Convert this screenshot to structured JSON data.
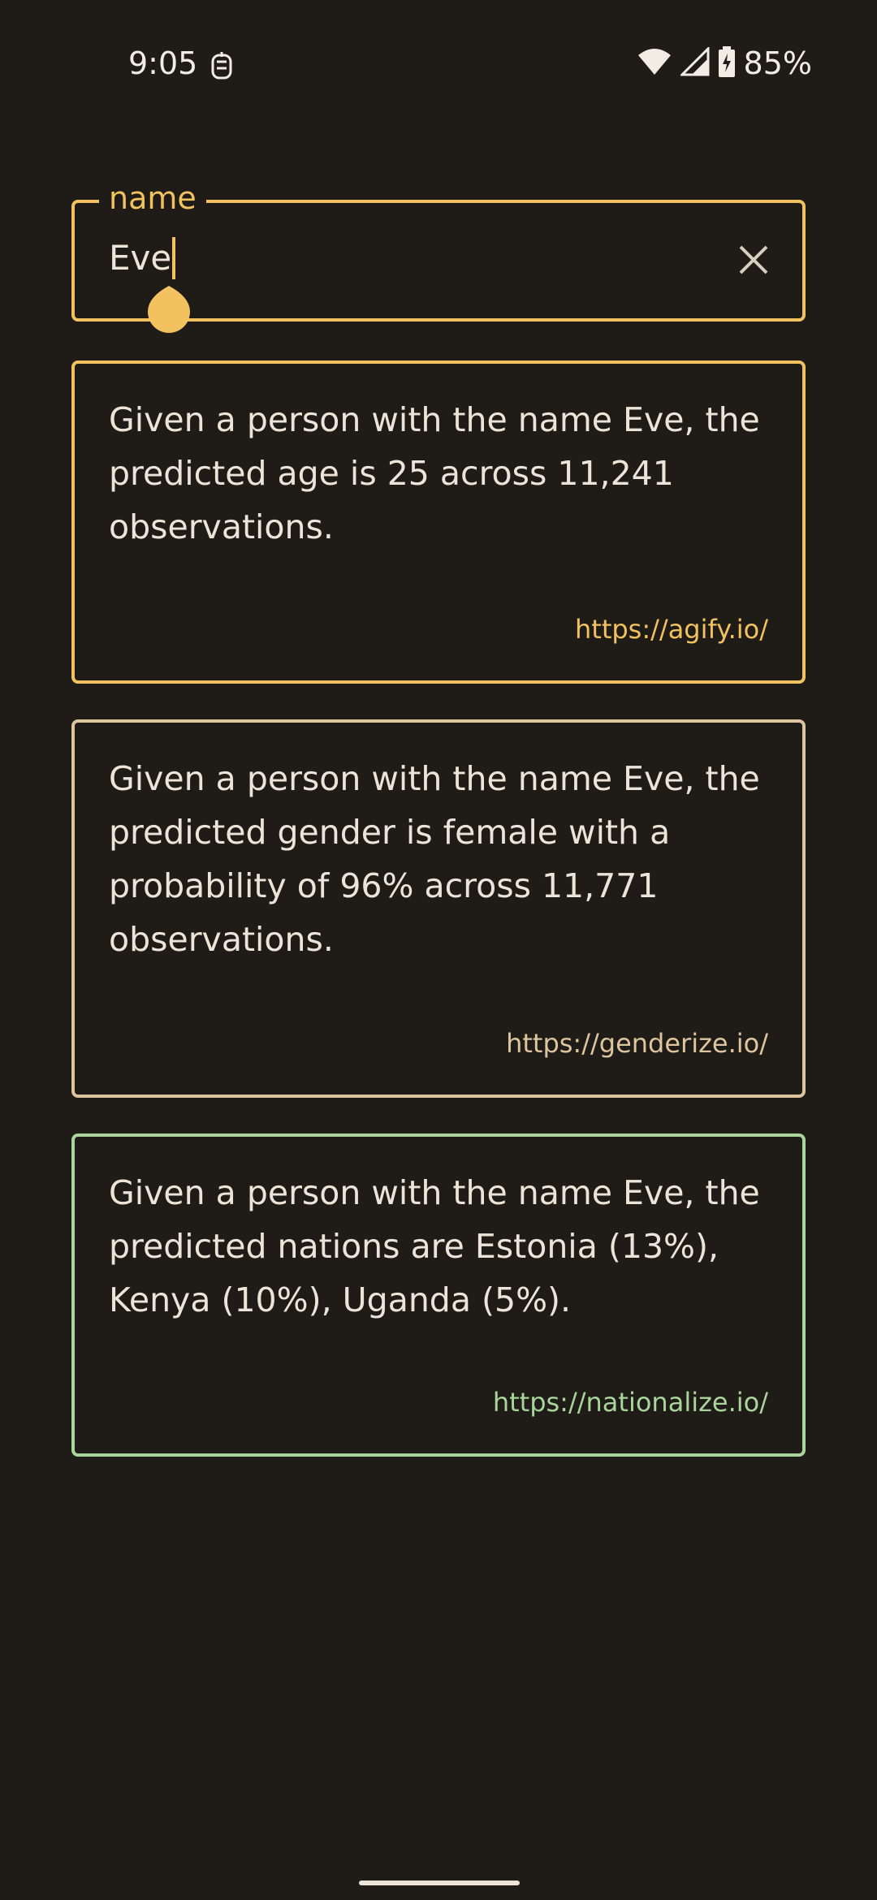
{
  "status_bar": {
    "time": "9:05",
    "battery": "85%",
    "icons": [
      "notification-icon",
      "wifi-icon",
      "cellular-signal-icon",
      "battery-charging-icon"
    ]
  },
  "name_field": {
    "label": "name",
    "value": "Eve",
    "clear_icon": "close-icon"
  },
  "results": {
    "age": {
      "text": "Given a person with the name Eve, the predicted age is 25 across 11,241 observations.",
      "link": "https://agify.io/"
    },
    "gender": {
      "text": "Given a person with the name Eve, the predicted gender is female with a probability of 96% across 11,771 observations.",
      "link": "https://genderize.io/"
    },
    "nationality": {
      "text": "Given a person with the name Eve, the predicted nations are Estonia (13%), Kenya (10%), Uganda (5%).",
      "link": "https://nationalize.io/"
    }
  },
  "colors": {
    "background": "#1f1b16",
    "age_accent": "#f1c25f",
    "gender_accent": "#dcc59f",
    "nation_accent": "#a9d49b",
    "text": "#ece4d8"
  }
}
